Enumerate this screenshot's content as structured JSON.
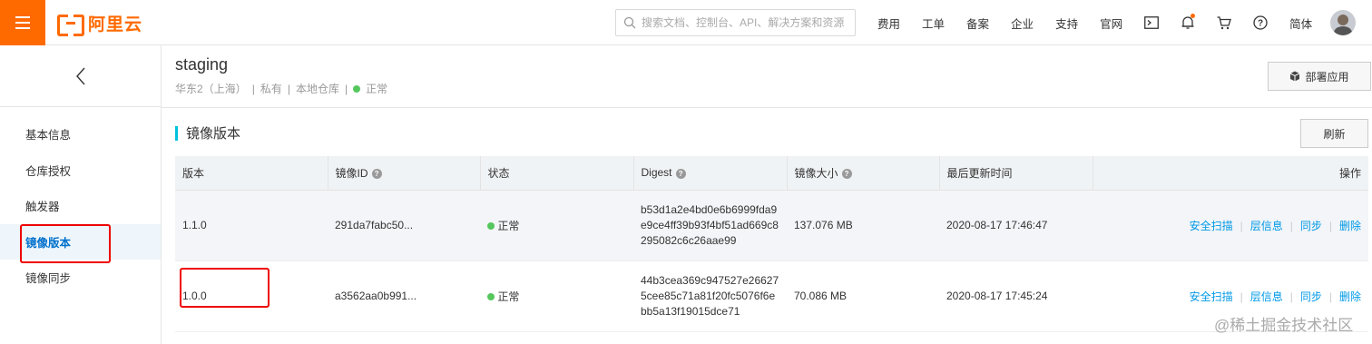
{
  "topbar": {
    "logo_text": "阿里云",
    "search_placeholder": "搜索文档、控制台、API、解决方案和资源",
    "nav": [
      "费用",
      "工单",
      "备案",
      "企业",
      "支持",
      "官网"
    ],
    "lang": "简体"
  },
  "sidebar": {
    "items": [
      {
        "label": "基本信息"
      },
      {
        "label": "仓库授权"
      },
      {
        "label": "触发器"
      },
      {
        "label": "镜像版本"
      },
      {
        "label": "镜像同步"
      }
    ]
  },
  "repo": {
    "name": "staging",
    "region": "华东2（上海）",
    "visibility": "私有",
    "source": "本地仓库",
    "status": "正常",
    "deploy_label": "部署应用"
  },
  "section": {
    "title": "镜像版本",
    "refresh_label": "刷新"
  },
  "table": {
    "headers": [
      "版本",
      "镜像ID",
      "状态",
      "Digest",
      "镜像大小",
      "最后更新时间",
      "操作"
    ],
    "rows": [
      {
        "version": "1.1.0",
        "image_id": "291da7fabc50...",
        "status": "正常",
        "digest": [
          "b53d1a2e4bd0e6b6999fda9",
          "e9ce4ff39b93f4bf51ad669c8",
          "295082c6c26aae99"
        ],
        "size": "137.076 MB",
        "updated": "2020-08-17 17:46:47"
      },
      {
        "version": "1.0.0",
        "image_id": "a3562aa0b991...",
        "status": "正常",
        "digest": [
          "44b3cea369c947527e26627",
          "5cee85c71a81f20fc5076f6e",
          "bb5a13f19015dce71"
        ],
        "size": "70.086 MB",
        "updated": "2020-08-17 17:45:24"
      }
    ],
    "actions": [
      "安全扫描",
      "层信息",
      "同步",
      "删除"
    ]
  },
  "watermark": "@稀土掘金技术社区",
  "colors": {
    "brand": "#ff6a00",
    "link": "#0099e6",
    "ok": "#55c75e",
    "accent": "#00c1de"
  }
}
